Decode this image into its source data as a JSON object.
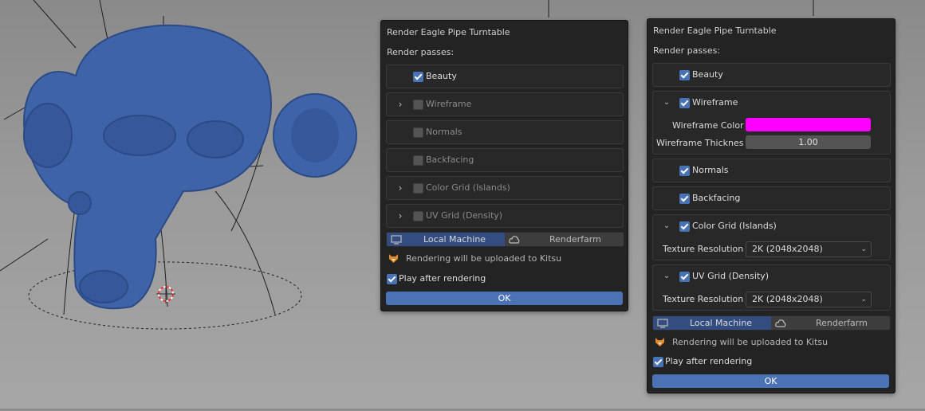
{
  "left_panel": {
    "title": "Render Eagle Pipe Turntable",
    "passes_label": "Render passes:",
    "passes": [
      {
        "label": "Beauty",
        "checked": true,
        "expandable": false
      },
      {
        "label": "Wireframe",
        "checked": false,
        "expandable": true
      },
      {
        "label": "Normals",
        "checked": false,
        "expandable": false
      },
      {
        "label": "Backfacing",
        "checked": false,
        "expandable": false
      },
      {
        "label": "Color Grid (Islands)",
        "checked": false,
        "expandable": true
      },
      {
        "label": "UV Grid (Density)",
        "checked": false,
        "expandable": true
      }
    ],
    "local_machine_label": "Local Machine",
    "renderfarm_label": "Renderfarm",
    "upload_note": "Rendering will be uploaded to Kitsu",
    "play_after_label": "Play after rendering",
    "ok_label": "OK"
  },
  "right_panel": {
    "title": "Render Eagle Pipe Turntable",
    "passes_label": "Render passes:",
    "beauty_label": "Beauty",
    "wireframe_label": "Wireframe",
    "wireframe_color_label": "Wireframe Color",
    "wireframe_color": "#ff00ff",
    "wireframe_thickness_label": "Wireframe Thicknes",
    "wireframe_thickness_value": "1.00",
    "normals_label": "Normals",
    "backfacing_label": "Backfacing",
    "color_grid_label": "Color Grid (Islands)",
    "texture_resolution_label": "Texture Resolution",
    "color_grid_resolution": "2K (2048x2048)",
    "uv_grid_label": "UV Grid (Density)",
    "uv_grid_resolution": "2K (2048x2048)",
    "local_machine_label": "Local Machine",
    "renderfarm_label": "Renderfarm",
    "upload_note": "Rendering will be uploaded to Kitsu",
    "play_after_label": "Play after rendering",
    "ok_label": "OK"
  },
  "colors": {
    "accent": "#4772b3",
    "panel_bg": "#232323",
    "model": "#3f63a8",
    "arrow": "#e4161b"
  }
}
